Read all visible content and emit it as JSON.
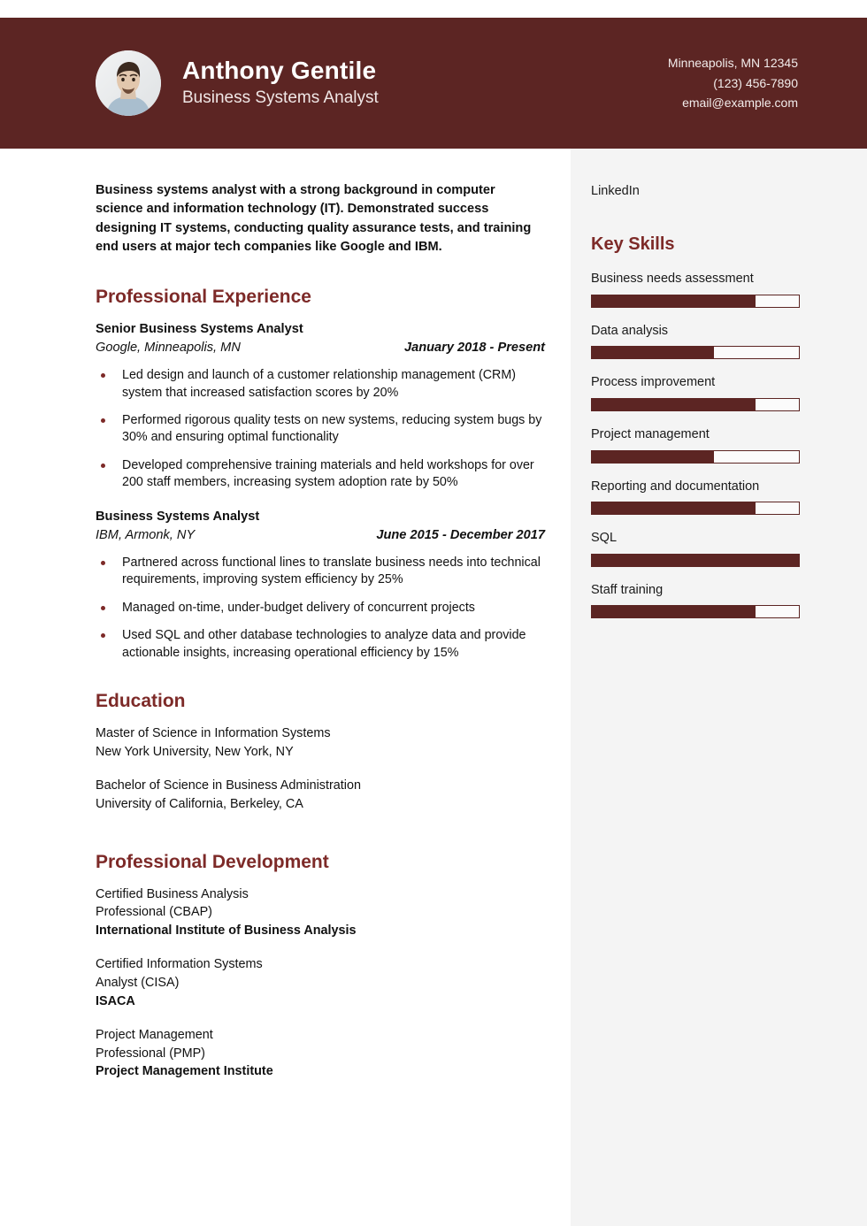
{
  "header": {
    "name": "Anthony Gentile",
    "title": "Business Systems Analyst",
    "avatar_icon": "person-photo-avatar",
    "contact": {
      "location": "Minneapolis, MN 12345",
      "phone": "(123) 456-7890",
      "email": "email@example.com"
    }
  },
  "theme": {
    "primary": "#5c2523",
    "heading": "#7d2a28",
    "sidebar_bg": "#f4f4f4",
    "page_bg": "#ffffff"
  },
  "summary": "Business systems analyst with a strong background in computer science and information technology (IT). Demonstrated success designing IT systems, conducting quality assurance tests, and training end users at major tech companies like Google and IBM.",
  "sections": {
    "experience_heading": "Professional Experience",
    "education_heading": "Education",
    "development_heading": "Professional Development"
  },
  "experience": [
    {
      "role": "Senior Business Systems Analyst",
      "company": "Google, Minneapolis, MN",
      "dates": "January 2018 - Present",
      "bullets": [
        "Led design and launch of a customer relationship management (CRM) system that increased satisfaction scores by 20%",
        "Performed rigorous quality tests on new systems, reducing system bugs by 30% and ensuring optimal functionality",
        "Developed comprehensive training materials and held workshops for over 200 staff members, increasing system adoption rate by 50%"
      ]
    },
    {
      "role": "Business Systems Analyst",
      "company": "IBM, Armonk, NY",
      "dates": "June 2015 - December 2017",
      "bullets": [
        "Partnered across functional lines to translate business needs into technical requirements, improving system efficiency by 25%",
        "Managed on-time, under-budget delivery of concurrent projects",
        "Used SQL and other database technologies to analyze data and provide actionable insights, increasing operational efficiency by 15%"
      ]
    }
  ],
  "education": [
    {
      "degree": "Master of Science in Information Systems",
      "school": "New York University, New York, NY"
    },
    {
      "degree": "Bachelor of Science in Business Administration",
      "school": "University of California, Berkeley, CA"
    }
  ],
  "development": [
    {
      "credential_line1": "Certified Business Analysis",
      "credential_line2": "Professional (CBAP)",
      "organization": "International Institute of Business Analysis"
    },
    {
      "credential_line1": "Certified Information Systems",
      "credential_line2": "Analyst (CISA)",
      "organization": "ISACA"
    },
    {
      "credential_line1": "Project Management",
      "credential_line2": "Professional (PMP)",
      "organization": "Project Management Institute"
    }
  ],
  "sidebar": {
    "linkedin_label": "LinkedIn",
    "skills_heading": "Key Skills",
    "skills": [
      {
        "name": "Business needs assessment",
        "level": 79
      },
      {
        "name": "Data analysis",
        "level": 59
      },
      {
        "name": "Process improvement",
        "level": 79
      },
      {
        "name": "Project management",
        "level": 59
      },
      {
        "name": "Reporting and documentation",
        "level": 79
      },
      {
        "name": "SQL",
        "level": 100
      },
      {
        "name": "Staff training",
        "level": 79
      }
    ]
  }
}
